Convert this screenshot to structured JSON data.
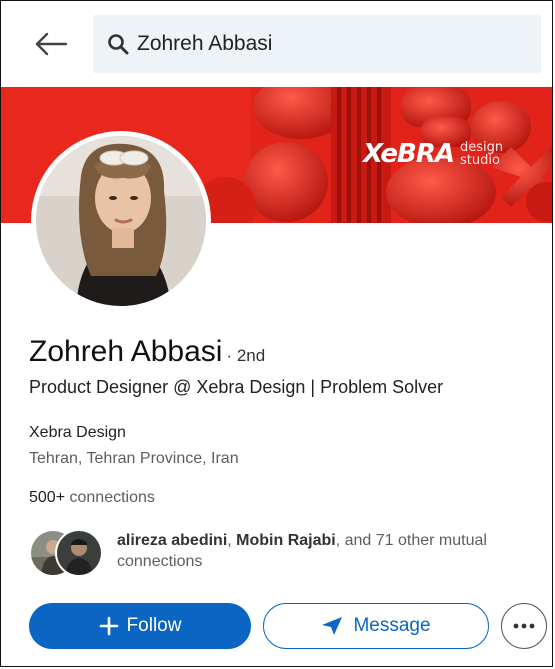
{
  "search": {
    "query": "Zohreh Abbasi"
  },
  "banner": {
    "brand_main": "XeBRA",
    "brand_sub_1": "design",
    "brand_sub_2": "studio",
    "color": "#e2231a"
  },
  "profile": {
    "name": "Zohreh Abbasi",
    "degree": "· 2nd",
    "headline": "Product Designer @ Xebra Design | Problem Solver",
    "company": "Xebra Design",
    "location": "Tehran, Tehran Province, Iran",
    "connections_count": "500+",
    "connections_label": "connections"
  },
  "mutual": {
    "name1": "alireza abedini",
    "separator": ", ",
    "name2": "Mobin Rajabi",
    "rest": ", and 71 other mutual connections"
  },
  "actions": {
    "follow_label": "Follow",
    "message_label": "Message"
  },
  "colors": {
    "primary": "#0a66c2",
    "search_bg": "#eef3f8"
  },
  "icons": [
    "back-arrow-icon",
    "search-icon",
    "plus-icon",
    "send-icon",
    "more-dots-icon"
  ]
}
